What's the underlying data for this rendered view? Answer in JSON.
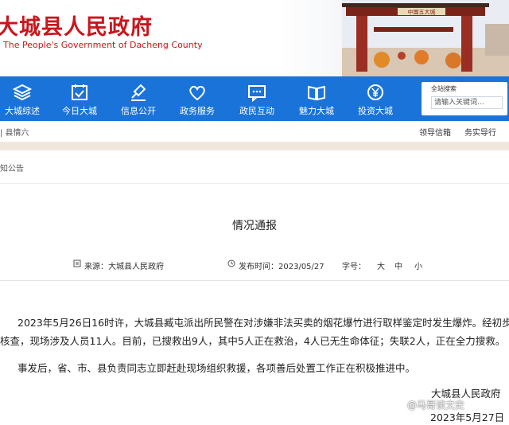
{
  "header": {
    "title": "大城县人民政府",
    "subtitle": "The People's Government of Dacheng County",
    "gate_sign": "中国五大城"
  },
  "nav": {
    "items": [
      {
        "label": "大城综述",
        "icon": "layers-icon"
      },
      {
        "label": "今日大城",
        "icon": "calendar-check-icon"
      },
      {
        "label": "信息公开",
        "icon": "stamp-icon"
      },
      {
        "label": "政务服务",
        "icon": "heart-icon"
      },
      {
        "label": "政民互动",
        "icon": "chat-icon"
      },
      {
        "label": "魅力大城",
        "icon": "book-icon"
      },
      {
        "label": "投资大城",
        "icon": "yuan-coin-icon"
      }
    ],
    "search": {
      "title": "全站搜索",
      "placeholder": "请输入关键词..."
    }
  },
  "subbar": {
    "location": "| 县情六",
    "links": [
      "领导信箱",
      "务实导行"
    ]
  },
  "breadcrumb": "知公告",
  "article": {
    "title": "情况通报",
    "meta": {
      "source": "来源：大城县人民政府",
      "published": "发布时间：2023/05/27",
      "font_label": "字号：",
      "font_sizes": [
        "大",
        "中",
        "小"
      ]
    },
    "paragraphs": [
      "2023年5月26日16时许，大城县臧屯派出所民警在对涉嫌非法买卖的烟花爆竹进行取样鉴定时发生爆炸。经初步",
      "核查，现场涉及人员11人。目前，已搜救出9人，其中5人正在救治，4人已无生命体征；失联2人，正在全力搜救。",
      "事发后，省、市、县负责同志立即赶赴现场组织救援，各项善后处置工作正在积极推进中。"
    ],
    "signature": "大城县人民政府",
    "date": "2023年5月27日"
  },
  "watermark": "@马哥谈文史",
  "colors": {
    "brand_red": "#c8161d",
    "nav_blue": "#1a73d9"
  }
}
